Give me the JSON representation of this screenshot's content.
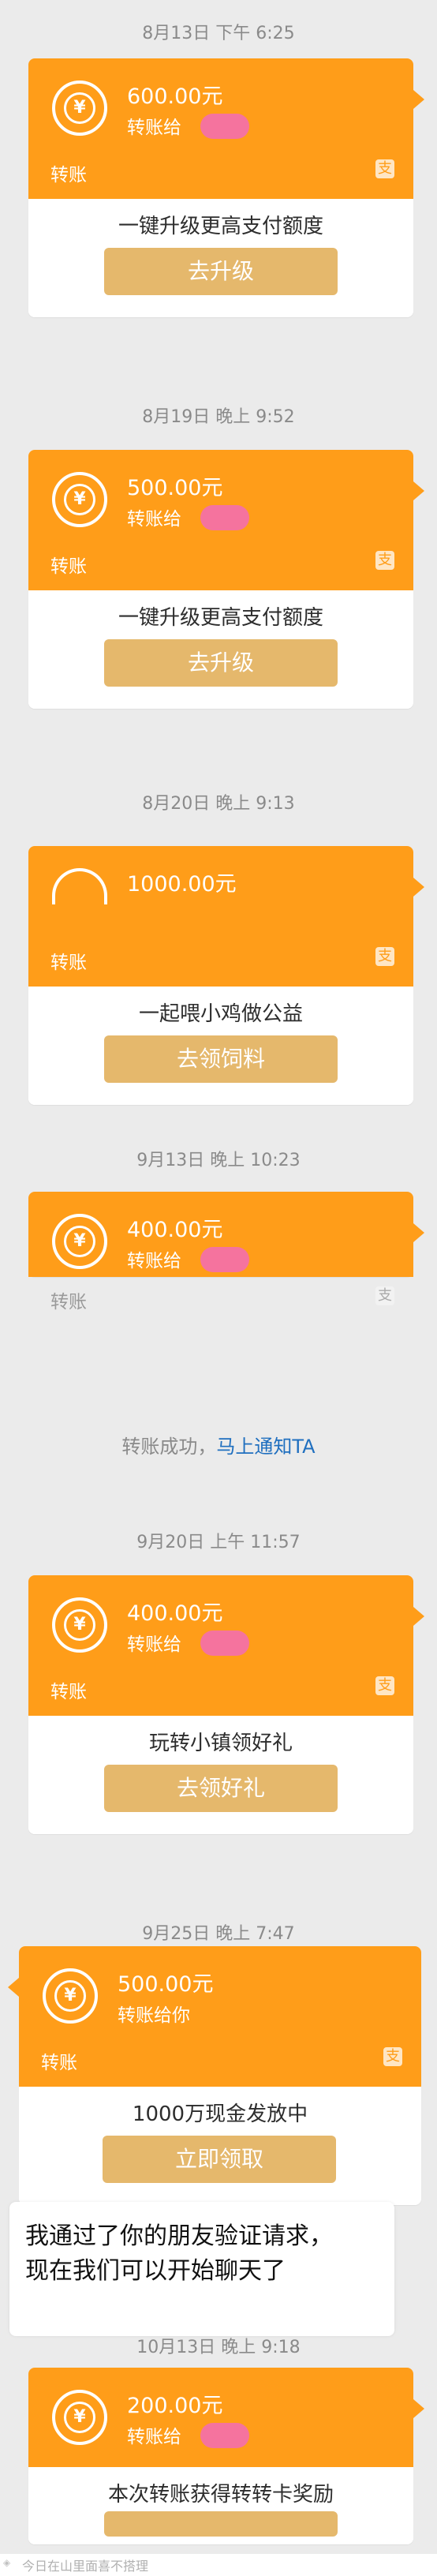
{
  "items": [
    {
      "timestamp": "8月13日 下午 6:25",
      "amount": "600.00元",
      "to_label": "转账给",
      "footer_label": "转账",
      "promo": "一键升级更高支付额度",
      "action": "去升级"
    },
    {
      "timestamp": "8月19日 晚上 9:52",
      "amount": "500.00元",
      "to_label": "转账给",
      "footer_label": "转账",
      "promo": "一键升级更高支付额度",
      "action": "去升级"
    },
    {
      "timestamp": "8月20日 晚上 9:13",
      "amount": "1000.00元",
      "footer_label": "转账",
      "promo": "一起喂小鸡做公益",
      "action": "去领饲料"
    },
    {
      "timestamp": "9月13日 晚上 10:23",
      "amount": "400.00元",
      "to_label": "转账给",
      "footer_label": "转账"
    },
    {
      "timestamp": "9月20日 上午 11:57",
      "amount": "400.00元",
      "to_label": "转账给",
      "footer_label": "转账",
      "promo": "玩转小镇领好礼",
      "action": "去领好礼"
    },
    {
      "timestamp": "9月25日 晚上 7:47",
      "amount": "500.00元",
      "to_label": "转账给你",
      "footer_label": "转账",
      "promo": "1000万现金发放中",
      "action": "立即领取"
    },
    {
      "timestamp": "10月13日 晚上 9:18",
      "amount": "200.00元",
      "to_label": "转账给",
      "promo": "本次转账获得转转卡奖励"
    }
  ],
  "success_text": "转账成功，",
  "success_link": "马上通知TA",
  "chat_line1": "我通过了你的朋友验证请求，",
  "chat_line2": "现在我们可以开始聊天了",
  "footer_text": "今日在山里面喜不搭理",
  "colors": {
    "orange": "#ff9d19",
    "button": "#e5b86c",
    "link": "#1f6fbf"
  },
  "icons": {
    "coin": "yuan-coin-icon",
    "alipay": "alipay-icon"
  }
}
